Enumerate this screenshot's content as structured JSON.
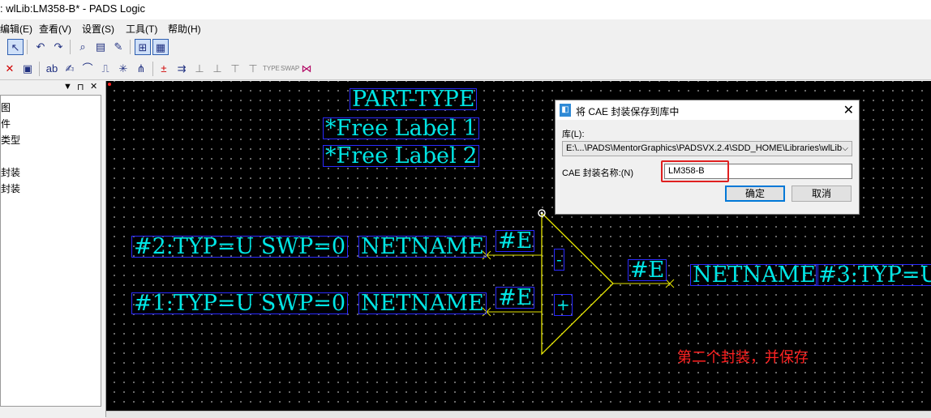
{
  "window": {
    "title": ": wlLib:LM358-B* - PADS Logic"
  },
  "menu": [
    "编辑(E)",
    "查看(V)",
    "设置(S)",
    "工具(T)",
    "帮助(H)"
  ],
  "panel": {
    "header_icons": [
      "▼",
      "⊓",
      "✕"
    ],
    "items": [
      "图",
      "件",
      "类型",
      "封装",
      "封装"
    ]
  },
  "canvas": {
    "labels": {
      "part_type": "PART-TYPE",
      "free1": "*Free Label 1",
      "free2": "*Free Label 2",
      "pin2": "#2:TYP=U SWP=0",
      "netname2": "NETNAME",
      "pin1": "#1:TYP=U SWP=0",
      "netname1": "NETNAME",
      "e_pin2": "#E",
      "e_pin1": "#E",
      "e_out": "#E",
      "minus": "-",
      "plus": "+",
      "netname3": "NETNAME",
      "pin3": "#3:TYP=U"
    },
    "note": "第二个封装，并保存",
    "note_color": "#ff2020",
    "label_color": "#00e6e6",
    "symbol_color": "#e6e600"
  },
  "dialog": {
    "title": "将 CAE 封装保存到库中",
    "library_label": "库(L):",
    "library_value": "E:\\...\\PADS\\MentorGraphics\\PADSVX.2.4\\SDD_HOME\\Libraries\\wlLib",
    "name_label": "CAE 封装名称:(N)",
    "name_value": "LM358-B",
    "ok": "确定",
    "cancel": "取消"
  }
}
